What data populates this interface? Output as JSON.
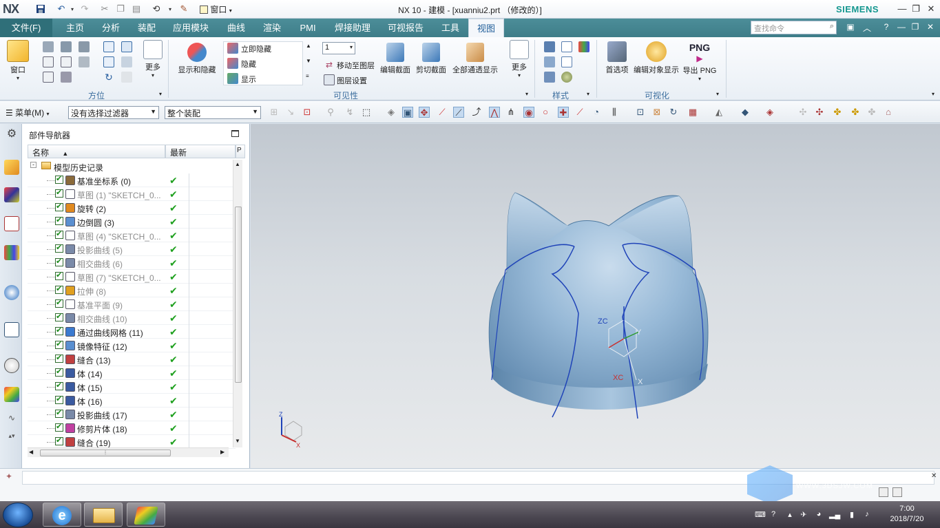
{
  "titlebar": {
    "logo": "NX",
    "window_menu": "窗口",
    "title": "NX 10 - 建模 - [xuanniu2.prt （修改的）]",
    "brand": "SIEMENS"
  },
  "tabs": [
    "文件(F)",
    "主页",
    "分析",
    "装配",
    "应用模块",
    "曲线",
    "渲染",
    "PMI",
    "焊接助理",
    "可视报告",
    "工具",
    "视图"
  ],
  "active_tab": "视图",
  "search": {
    "placeholder": "查找命令"
  },
  "ribbon": {
    "groups": {
      "orientation": "方位",
      "visibility": "可见性",
      "style": "样式",
      "visualization": "可视化"
    },
    "buttons": {
      "window": "窗口",
      "more1": "更多",
      "show_hide": "显示和隐藏",
      "immediate_hide": "立即隐藏",
      "hide": "隐藏",
      "show": "显示",
      "layer_value": "1",
      "move_to_layer": "移动至图层",
      "layer_settings": "图层设置",
      "edit_section": "编辑截面",
      "clip_section": "剪切截面",
      "all_show": "全部通透显示",
      "more2": "更多",
      "preferences": "首选项",
      "edit_display": "编辑对象显示",
      "export_png_top": "PNG",
      "export_png": "导出 PNG"
    }
  },
  "cmdbar": {
    "menu": "菜单(M)",
    "filter": "没有选择过滤器",
    "assembly": "整个装配"
  },
  "navigator": {
    "title": "部件导航器",
    "col_name": "名称",
    "col_latest": "最新",
    "root": "模型历史记录",
    "rows": [
      {
        "name": "基准坐标系 (0)",
        "gray": false
      },
      {
        "name": "草图 (1) \"SKETCH_0...",
        "gray": true
      },
      {
        "name": "旋转 (2)",
        "gray": false
      },
      {
        "name": "边倒圆 (3)",
        "gray": false
      },
      {
        "name": "草图 (4) \"SKETCH_0...",
        "gray": true
      },
      {
        "name": "投影曲线 (5)",
        "gray": true
      },
      {
        "name": "相交曲线 (6)",
        "gray": true
      },
      {
        "name": "草图 (7) \"SKETCH_0...",
        "gray": true
      },
      {
        "name": "拉伸 (8)",
        "gray": true
      },
      {
        "name": "基准平面 (9)",
        "gray": true
      },
      {
        "name": "相交曲线 (10)",
        "gray": true
      },
      {
        "name": "通过曲线网格 (11)",
        "gray": false
      },
      {
        "name": "镜像特征 (12)",
        "gray": false
      },
      {
        "name": "缝合 (13)",
        "gray": false
      },
      {
        "name": "体 (14)",
        "gray": false
      },
      {
        "name": "体 (15)",
        "gray": false
      },
      {
        "name": "体 (16)",
        "gray": false
      },
      {
        "name": "投影曲线 (17)",
        "gray": false
      },
      {
        "name": "修剪片体 (18)",
        "gray": false
      },
      {
        "name": "缝合 (19)",
        "gray": false
      }
    ]
  },
  "viewport": {
    "csys_zc": "ZC",
    "csys_yc": "Y",
    "csys_xc": "XC",
    "csys_x": "X",
    "triad_z": "Z",
    "triad_x": "X",
    "watermark": "WWW.3DSJW.COM"
  },
  "taskbar": {
    "time": "7:00",
    "date": "2018/7/20"
  },
  "colors": {
    "tab_bar": "#3e7d88",
    "model": "#8fb4d4",
    "check": "#1fa01f"
  }
}
